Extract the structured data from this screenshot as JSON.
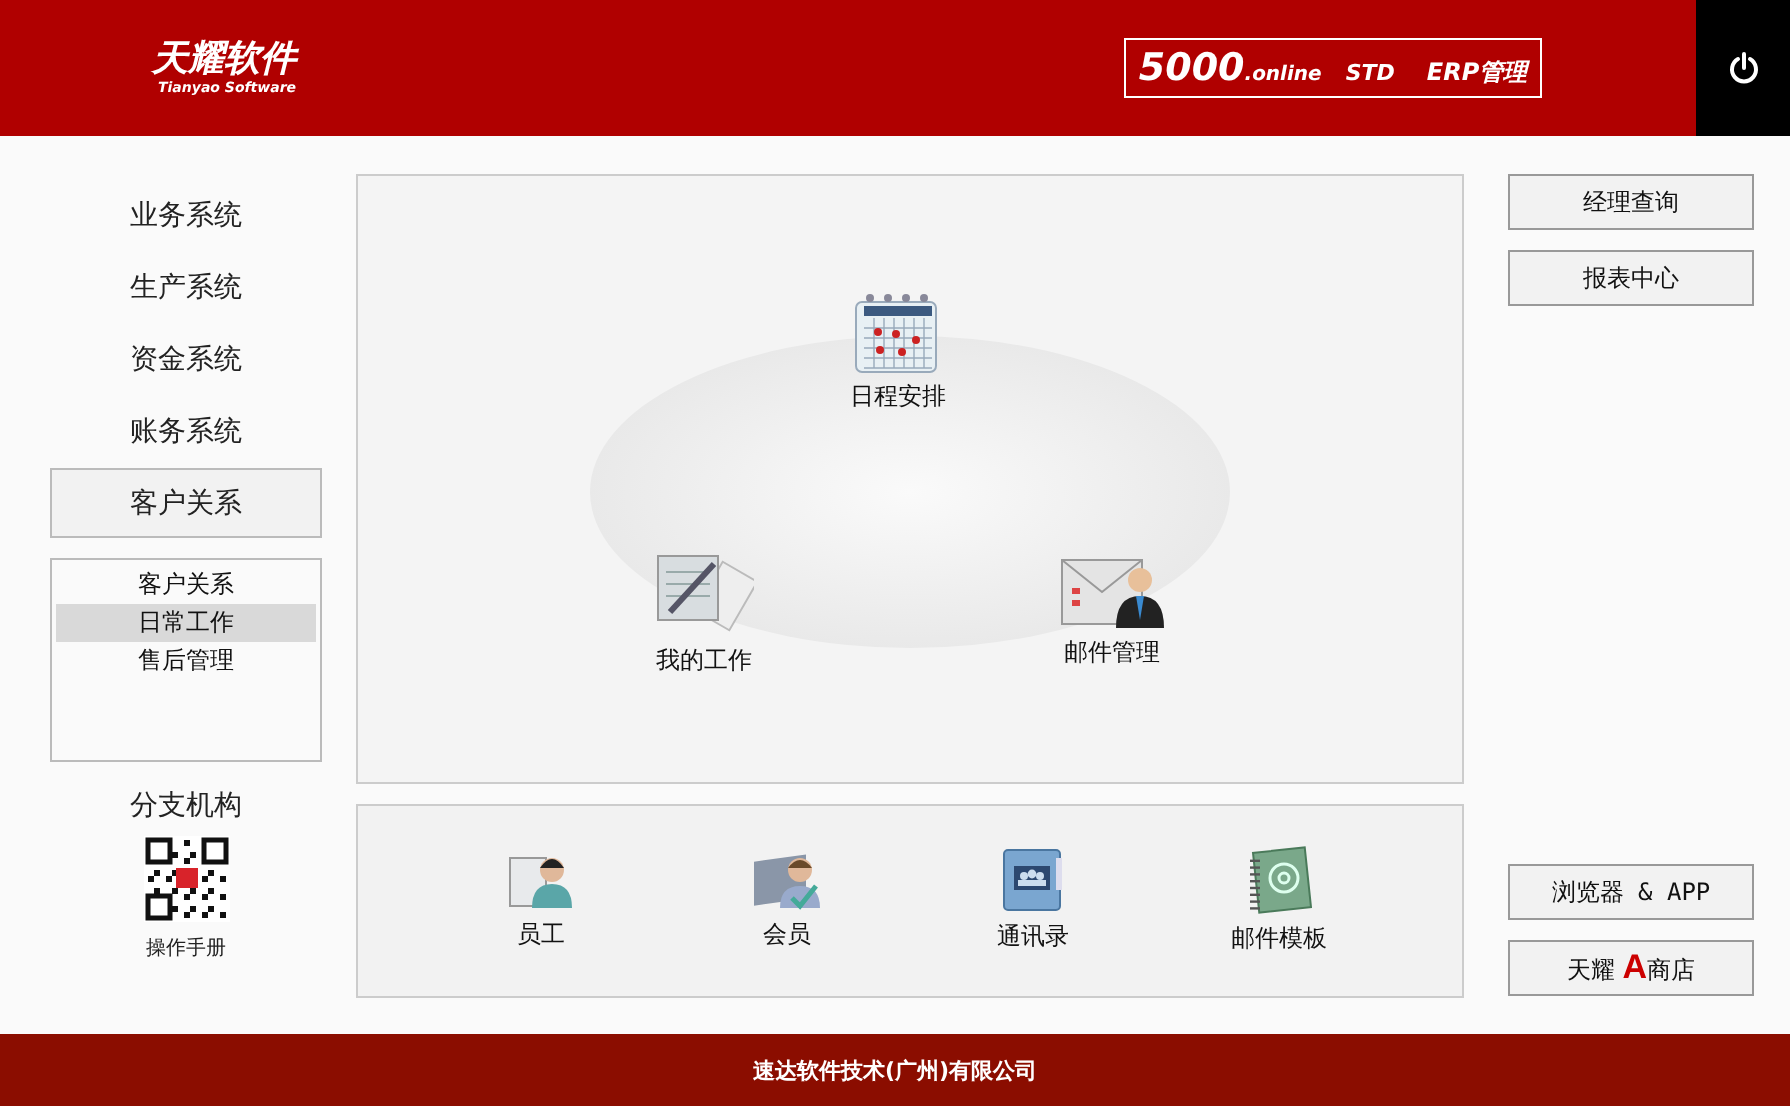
{
  "header": {
    "logo": "天耀软件",
    "logo_sub": "Tianyao Software",
    "edition": {
      "number": "5000",
      "suffix": ".online",
      "tier": "STD",
      "product": "ERP管理"
    }
  },
  "nav": [
    {
      "label": "业务系统",
      "selected": false
    },
    {
      "label": "生产系统",
      "selected": false
    },
    {
      "label": "资金系统",
      "selected": false
    },
    {
      "label": "账务系统",
      "selected": false
    },
    {
      "label": "客户关系",
      "selected": true
    }
  ],
  "sub_list": [
    {
      "label": "客户关系",
      "selected": false
    },
    {
      "label": "日常工作",
      "selected": true
    },
    {
      "label": "售后管理",
      "selected": false
    }
  ],
  "branch": {
    "title": "分支机构",
    "qr_caption": "操作手册"
  },
  "workflow": [
    {
      "label": "日程安排"
    },
    {
      "label": "我的工作"
    },
    {
      "label": "邮件管理"
    }
  ],
  "shortcuts": [
    {
      "label": "员工"
    },
    {
      "label": "会员"
    },
    {
      "label": "通讯录"
    },
    {
      "label": "邮件模板"
    }
  ],
  "right_top": [
    "经理查询",
    "报表中心"
  ],
  "browser_button": "浏览器 & APP",
  "store_button": {
    "before": "天耀",
    "accent": "A",
    "after": "商店"
  },
  "footer": "速达软件技术(广州)有限公司"
}
